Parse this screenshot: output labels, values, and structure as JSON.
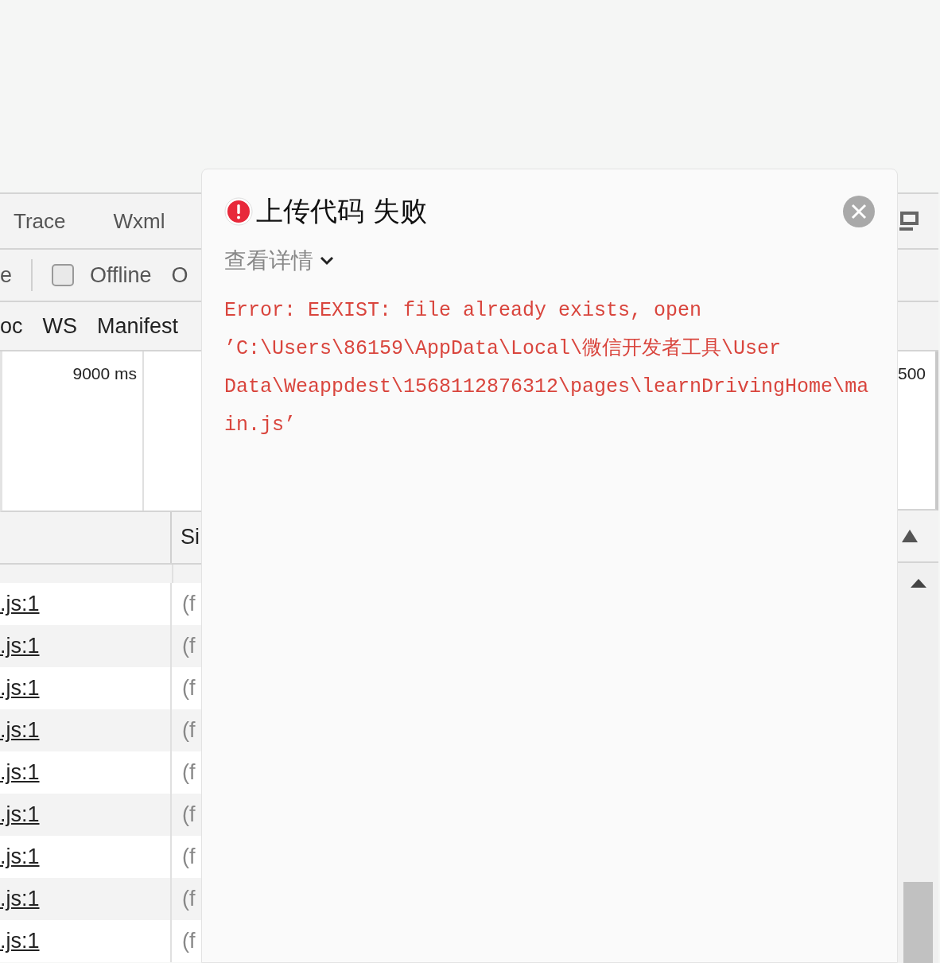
{
  "devtools_tabs": [
    {
      "label": "Trace",
      "selected": false
    },
    {
      "label": "Wxml",
      "selected": false
    }
  ],
  "toolbar": {
    "cut_label": "e",
    "offline": {
      "label": "Offline",
      "checked": false
    },
    "next_label": "O"
  },
  "filters": [
    {
      "label": "oc"
    },
    {
      "label": "WS"
    },
    {
      "label": "Manifest"
    }
  ],
  "overview": {
    "tick": "9000 ms",
    "right_tick": "500"
  },
  "table": {
    "columns": [
      "Si"
    ],
    "rows": [
      {
        "name": ".js:1",
        "column_2": "(f"
      },
      {
        "name": ".js:1",
        "column_2": "(f"
      },
      {
        "name": ".js:1",
        "column_2": "(f"
      },
      {
        "name": ".js:1",
        "column_2": "(f"
      },
      {
        "name": ".js:1",
        "column_2": "(f"
      },
      {
        "name": ".js:1",
        "column_2": "(f"
      },
      {
        "name": ".js:1",
        "column_2": "(f"
      },
      {
        "name": ".js:1",
        "column_2": "(f"
      },
      {
        "name": ".js:1",
        "column_2": "(f"
      }
    ]
  },
  "dialog": {
    "title": "上传代码 失败",
    "details_label": "查看详情",
    "error": "Error: EEXIST: file already exists, open ’C:\\Users\\86159\\AppData\\Local\\微信开发者工具\\User Data\\Weappdest\\1568112876312\\pages\\learnDrivingHome\\main.js’"
  }
}
